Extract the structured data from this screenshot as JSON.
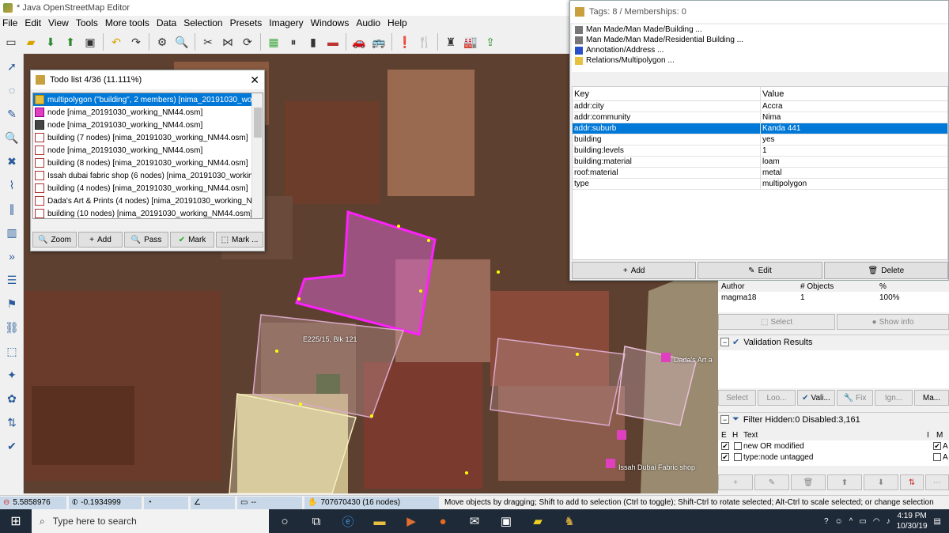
{
  "window": {
    "title": "* Java OpenStreetMap Editor"
  },
  "menu": [
    "File",
    "Edit",
    "View",
    "Tools",
    "More tools",
    "Data",
    "Selection",
    "Presets",
    "Imagery",
    "Windows",
    "Audio",
    "Help"
  ],
  "todo": {
    "title": "Todo list 4/36 (11.111%)",
    "items": [
      "multipolygon (\"building\", 2 members) [nima_20191030_working",
      "node [nima_20191030_working_NM44.osm]",
      "node [nima_20191030_working_NM44.osm]",
      "building (7 nodes) [nima_20191030_working_NM44.osm]",
      "node [nima_20191030_working_NM44.osm]",
      "building (8 nodes) [nima_20191030_working_NM44.osm]",
      "Issah dubai fabric shop (6 nodes) [nima_20191030_working_",
      "building (4 nodes) [nima_20191030_working_NM44.osm]",
      "Dada's Art & Prints (4 nodes) [nima_20191030_working_NM4",
      "building (10 nodes) [nima_20191030_working_NM44.osm]"
    ],
    "buttons": [
      "Zoom",
      "Add",
      "Pass",
      "Mark",
      "Mark ..."
    ]
  },
  "tags": {
    "title": "Tags: 8 / Memberships: 0",
    "presets": [
      "Man Made/Man Made/Building ...",
      "Man Made/Man Made/Residential Building ...",
      "Annotation/Address ...",
      "Relations/Multipolygon ..."
    ],
    "col_key": "Key",
    "col_value": "Value",
    "rows": [
      {
        "k": "addr:city",
        "v": "Accra"
      },
      {
        "k": "addr:community",
        "v": "Nima"
      },
      {
        "k": "addr:suburb",
        "v": "Kanda 441"
      },
      {
        "k": "building",
        "v": "yes"
      },
      {
        "k": "building:levels",
        "v": "1"
      },
      {
        "k": "building:material",
        "v": "loam"
      },
      {
        "k": "roof:material",
        "v": "metal"
      },
      {
        "k": "type",
        "v": "multipolygon"
      }
    ],
    "add": "Add",
    "edit": "Edit",
    "delete": "Delete"
  },
  "authors": {
    "h_author": "Author",
    "h_objects": "# Objects",
    "h_pct": "%",
    "author": "magma18",
    "objects": "1",
    "pct": "100%"
  },
  "select_btn": "Select",
  "showinfo_btn": "Show info",
  "validation": {
    "title": "Validation Results",
    "buttons": [
      "Select",
      "Loo...",
      "Vali...",
      "Fix",
      "Ign...",
      "Ma..."
    ]
  },
  "filter": {
    "title": "Filter Hidden:0 Disabled:3,161",
    "h_e": "E",
    "h_h": "H",
    "h_text": "Text",
    "h_i": "I",
    "h_m": "M",
    "rows": [
      "new OR modified",
      "type:node untagged"
    ],
    "right": [
      "A",
      "A"
    ]
  },
  "map": {
    "label1": "E225/15, Blk 121",
    "label2": "Dada's Art a",
    "label3": "Issah Dubai Fabric shop"
  },
  "status": {
    "lat": "5.5858976",
    "lon": "-0.1934999",
    "len": "--",
    "obj": "707670430 (16 nodes)",
    "help": "Move objects by dragging; Shift to add to selection (Ctrl to toggle); Shift-Ctrl to rotate selected; Alt-Ctrl to scale selected; or change selection"
  },
  "taskbar": {
    "search": "Type here to search",
    "time": "4:19 PM",
    "date": "10/30/19"
  }
}
